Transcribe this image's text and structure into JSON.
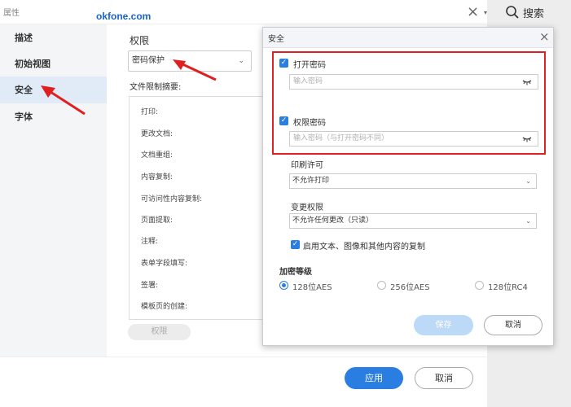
{
  "window": {
    "title": "属性",
    "watermark": "okfone.com",
    "close_glyph": "×",
    "chevron_glyph": "▾"
  },
  "search": {
    "label": "搜索",
    "icon": "search-icon"
  },
  "sidebar": {
    "items": [
      {
        "label": "描述"
      },
      {
        "label": "初始视图"
      },
      {
        "label": "安全"
      },
      {
        "label": "字体"
      }
    ]
  },
  "content": {
    "perm_label": "权限",
    "perm_select_value": "密码保护",
    "summary_label": "文件限制摘要:",
    "summary_items": [
      "打印:",
      "更改文档:",
      "文档重组:",
      "内容复制:",
      "可访问性内容复制:",
      "页面提取:",
      "注释:",
      "表单字段填写:",
      "签署:",
      "模板页的创建:"
    ],
    "perm_button": "权限"
  },
  "footer": {
    "apply": "应用",
    "cancel": "取消"
  },
  "security_dialog": {
    "title": "安全",
    "close_glyph": "×",
    "open_pwd": {
      "checked": true,
      "label": "打开密码",
      "placeholder": "输入密码"
    },
    "perm_pwd": {
      "checked": true,
      "label": "权限密码",
      "placeholder": "输入密码（与打开密码不同）"
    },
    "print_label": "印刷许可",
    "print_value": "不允许打印",
    "change_label": "变更权限",
    "change_value": "不允许任何更改（只读）",
    "copy_enable": {
      "checked": true,
      "label": "启用文本、图像和其他内容的复制"
    },
    "enc_label": "加密等级",
    "enc_options": [
      {
        "label": "128位AES",
        "selected": true
      },
      {
        "label": "256位AES",
        "selected": false
      },
      {
        "label": "128位RC4",
        "selected": false
      }
    ],
    "save": "保存",
    "cancel": "取消"
  },
  "colors": {
    "accent": "#2a7de1",
    "highlight": "#e02020"
  }
}
